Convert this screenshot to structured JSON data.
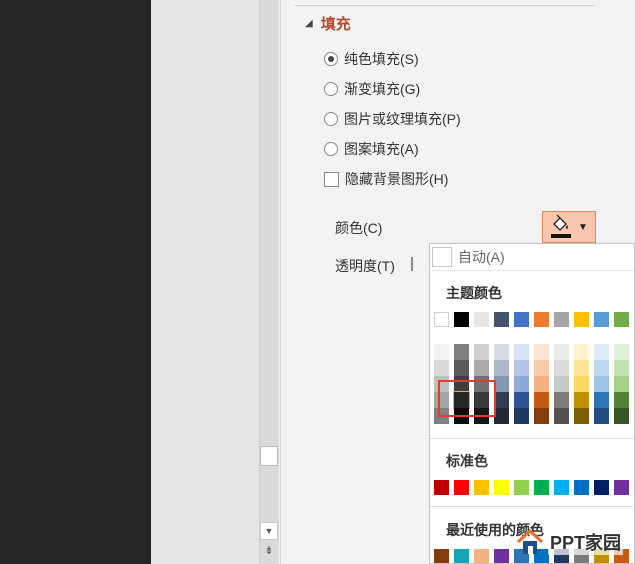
{
  "fill_section": {
    "title": "填充"
  },
  "fill_options": [
    {
      "label": "纯色填充(S)",
      "checked": true
    },
    {
      "label": "渐变填充(G)",
      "checked": false
    },
    {
      "label": "图片或纹理填充(P)",
      "checked": false
    },
    {
      "label": "图案填充(A)",
      "checked": false
    }
  ],
  "hide_background": {
    "label": "隐藏背景图形(H)",
    "checked": false
  },
  "color": {
    "label": "颜色(C)",
    "icon": "paint-bucket-icon",
    "current": "#111111"
  },
  "transparency": {
    "label": "透明度(T)"
  },
  "color_menu": {
    "auto_label": "自动(A)",
    "theme_heading": "主题颜色",
    "theme_top": [
      "#ffffff",
      "#000000",
      "#e7e6e6",
      "#44546a",
      "#4472c4",
      "#ed7d31",
      "#a5a5a5",
      "#ffc000",
      "#5b9bd5",
      "#70ad47"
    ],
    "theme_shades": [
      [
        "#f2f2f2",
        "#7f7f7f",
        "#d0cece",
        "#d6dce4",
        "#d9e2f3",
        "#fbe5d5",
        "#ededed",
        "#fff2cc",
        "#deeaf6",
        "#e2efd9"
      ],
      [
        "#d9d9d9",
        "#595959",
        "#aeaaaa",
        "#adb9ca",
        "#b4c6e7",
        "#f7caac",
        "#dbdbdb",
        "#fee599",
        "#bdd7ee",
        "#c5e0b3"
      ],
      [
        "#bfbfbf",
        "#3f3f3f",
        "#757070",
        "#8496b0",
        "#8eaadb",
        "#f4b183",
        "#c9c9c9",
        "#ffd965",
        "#9cc3e5",
        "#a8d08d"
      ],
      [
        "#a6a6a6",
        "#262626",
        "#3a3838",
        "#323f4f",
        "#2f5496",
        "#c55a11",
        "#7b7b7b",
        "#bf9000",
        "#2e75b5",
        "#538135"
      ],
      [
        "#7f7f7f",
        "#0c0c0c",
        "#171616",
        "#222a35",
        "#1f3864",
        "#833c0b",
        "#525252",
        "#7f6000",
        "#1e4e79",
        "#375623"
      ]
    ],
    "standard_heading": "标准色",
    "standard": [
      "#c00000",
      "#ff0000",
      "#ffc000",
      "#ffff00",
      "#92d050",
      "#00b050",
      "#00b0f0",
      "#0070c0",
      "#002060",
      "#7030a0"
    ],
    "recent_heading": "最近使用的颜色",
    "recent": [
      "#833c0b",
      "#17a2b8",
      "#f4b183",
      "#7030a0",
      "#2e75b5",
      "#0070c0",
      "#203864",
      "#7b7b7b",
      "#bf9000",
      "#c55a11"
    ]
  },
  "watermark": {
    "text": "PPT家园"
  }
}
